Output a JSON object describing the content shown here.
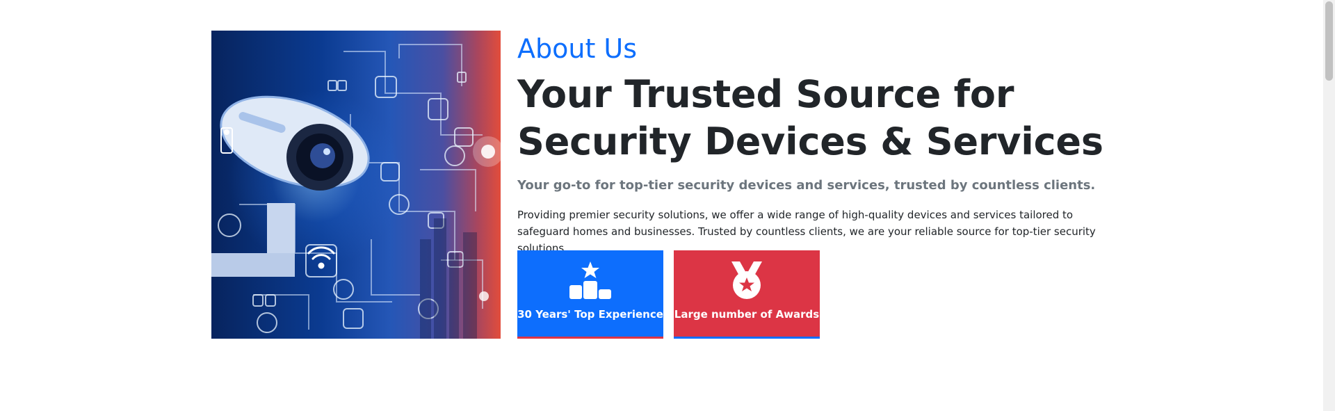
{
  "about": {
    "eyebrow": "About Us",
    "headline": "Your Trusted Source for Security Devices & Services",
    "lead": "Your go-to for top-tier security devices and services, trusted by countless clients.",
    "body": "Providing premier security solutions, we offer a wide range of high-quality devices and services tailored to safeguard homes and businesses. Trusted by countless clients, we are your reliable source for top-tier security solutions.",
    "features": [
      {
        "label": "30 Years' Top Experience",
        "icon": "podium-star-icon",
        "color": "#0d6efd",
        "border": "#dc3545"
      },
      {
        "label": "Large number of Awards",
        "icon": "award-medal-icon",
        "color": "#dc3545",
        "border": "#0d6efd"
      }
    ]
  },
  "colors": {
    "primary": "#0d6efd",
    "danger": "#dc3545",
    "heading": "#212529",
    "muted": "#6c757d"
  }
}
